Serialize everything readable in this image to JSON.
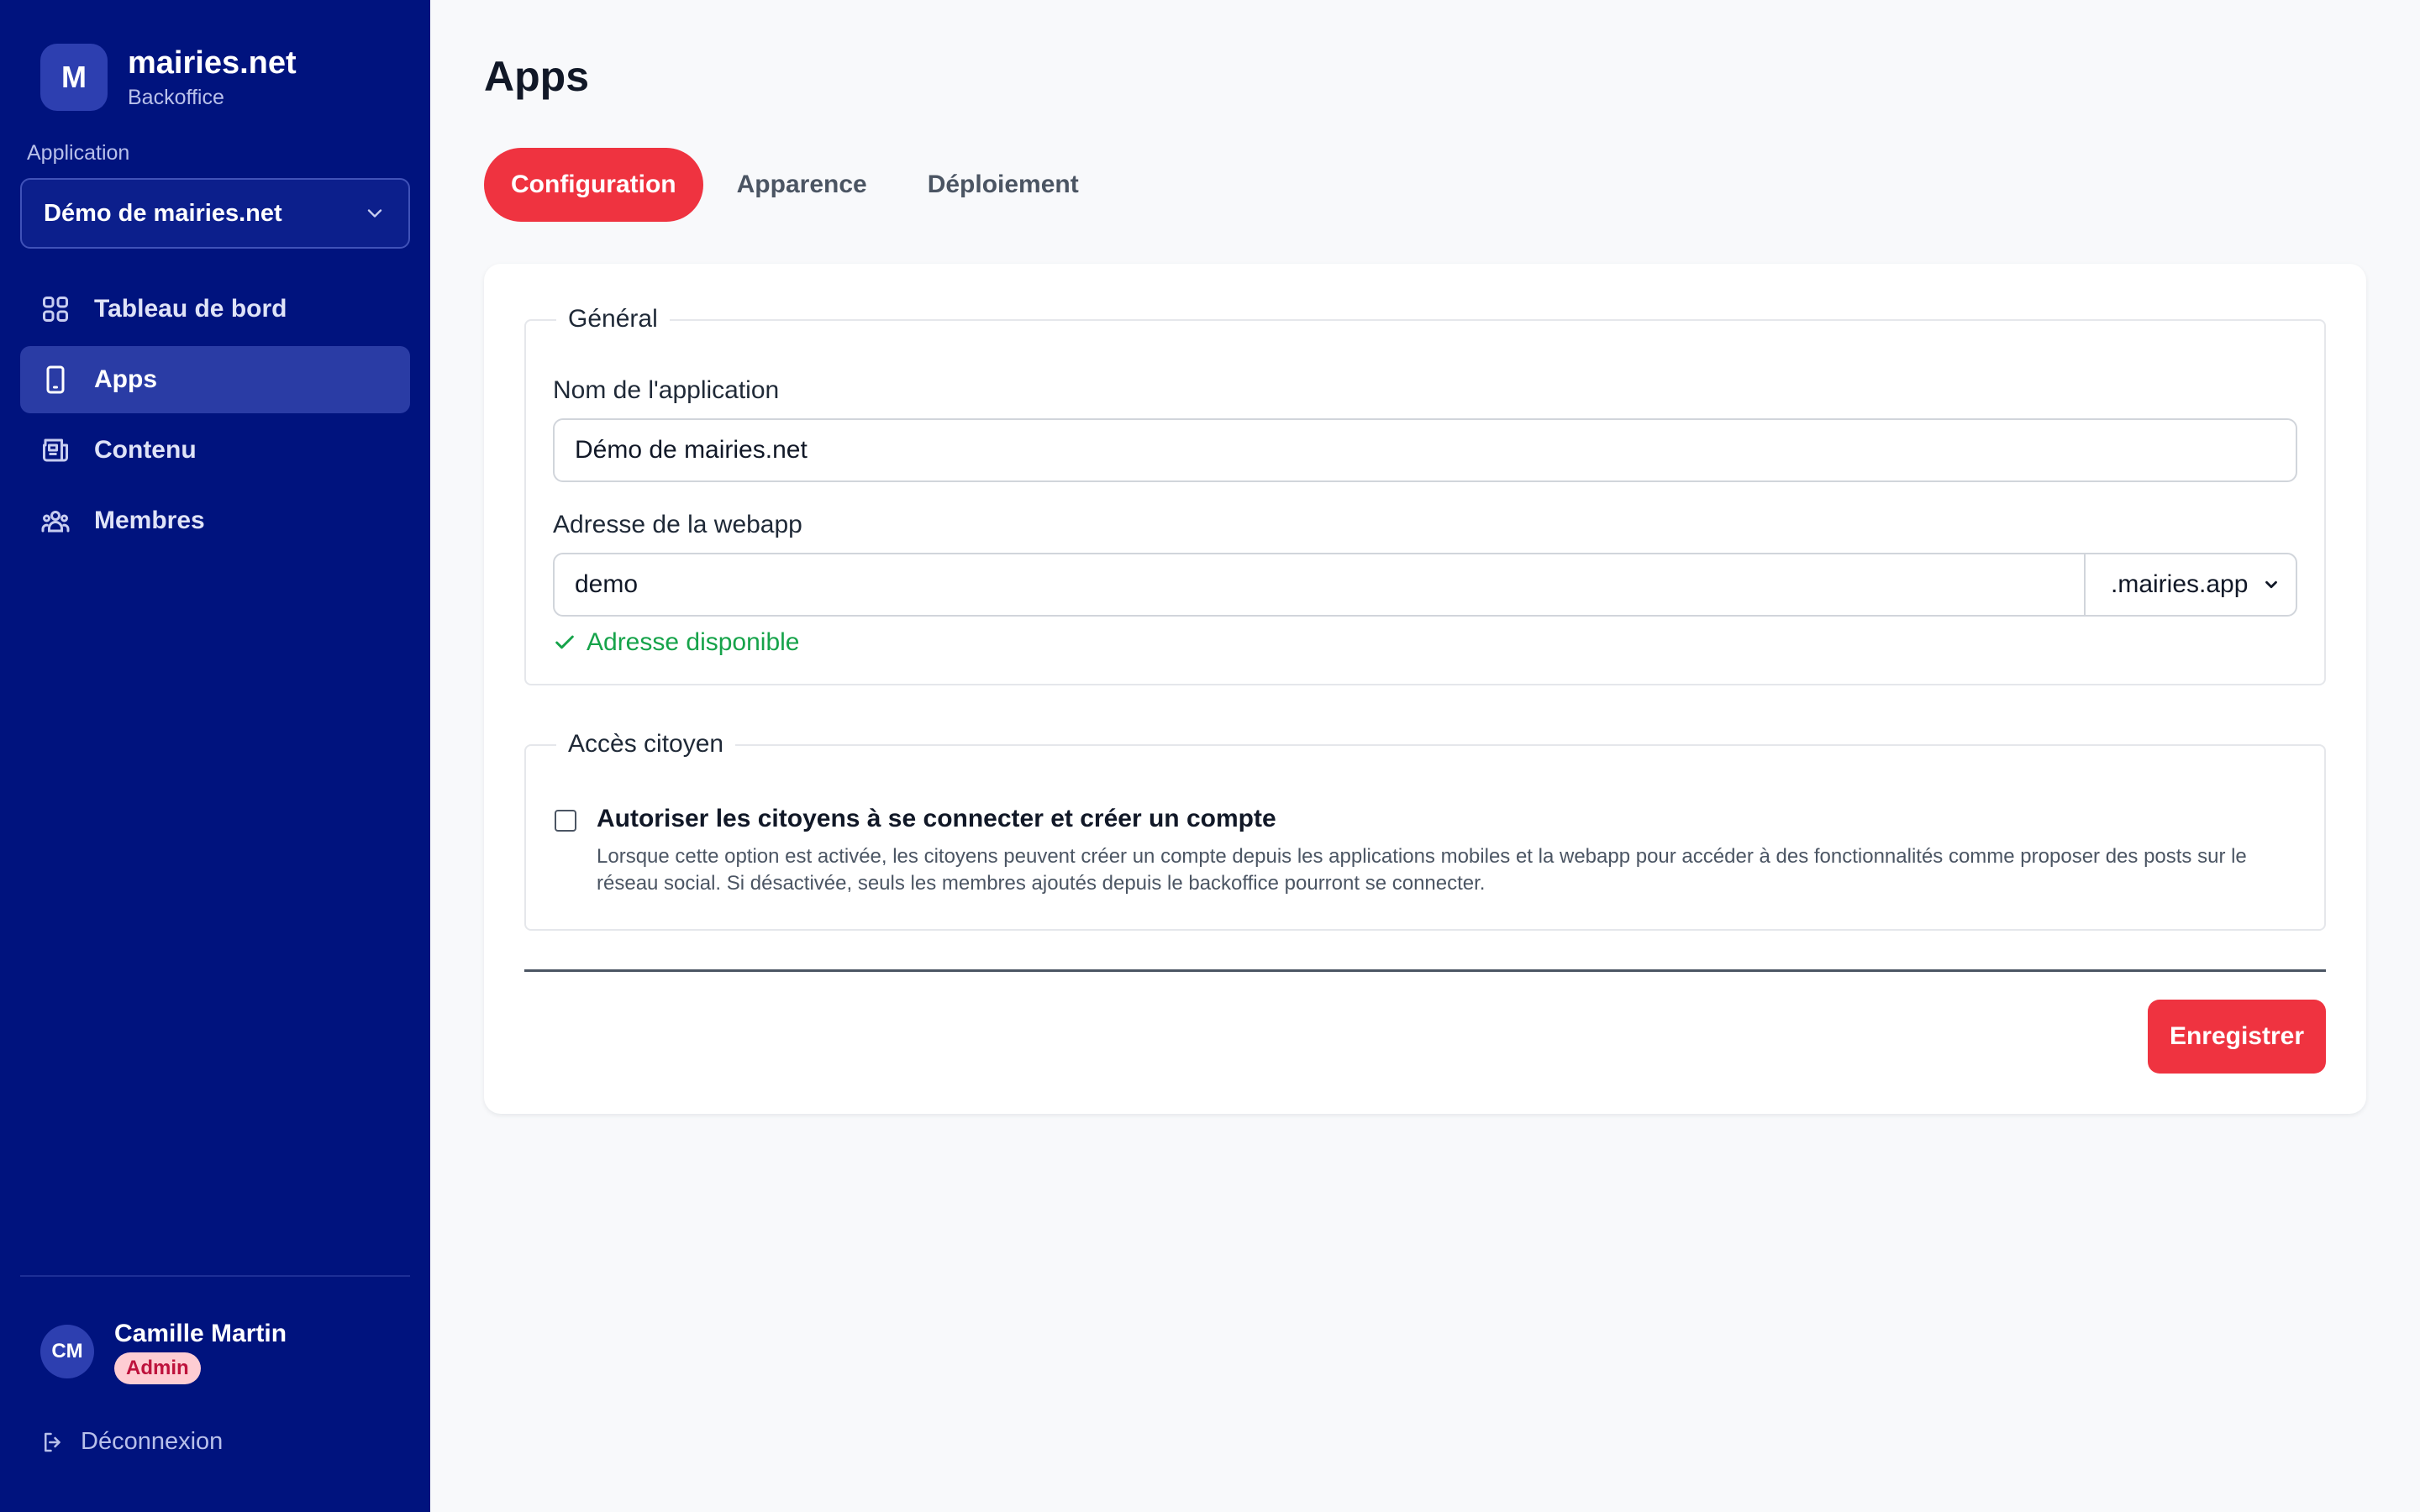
{
  "brand": {
    "initial": "M",
    "name": "mairies.net",
    "subtitle": "Backoffice"
  },
  "sidebar": {
    "application_label": "Application",
    "application_selected": "Démo de mairies.net",
    "nav": [
      {
        "label": "Tableau de bord",
        "icon": "grid-icon"
      },
      {
        "label": "Apps",
        "icon": "smartphone-icon",
        "active": true
      },
      {
        "label": "Contenu",
        "icon": "newspaper-icon"
      },
      {
        "label": "Membres",
        "icon": "users-icon"
      }
    ],
    "user": {
      "initials": "CM",
      "name": "Camille Martin",
      "role": "Admin"
    },
    "logout_label": "Déconnexion"
  },
  "page": {
    "title": "Apps",
    "tabs": [
      {
        "label": "Configuration",
        "active": true
      },
      {
        "label": "Apparence"
      },
      {
        "label": "Déploiement"
      }
    ]
  },
  "general": {
    "legend": "Général",
    "app_name_label": "Nom de l'application",
    "app_name_value": "Démo de mairies.net",
    "webapp_label": "Adresse de la webapp",
    "webapp_value": "demo",
    "webapp_suffix": ".mairies.app",
    "availability": "Adresse disponible"
  },
  "citizen": {
    "legend": "Accès citoyen",
    "allow_label": "Autoriser les citoyens à se connecter et créer un compte",
    "allow_checked": false,
    "description": "Lorsque cette option est activée, les citoyens peuvent créer un compte depuis les applications mobiles et la webapp pour accéder à des fonctionnalités comme proposer des posts sur le réseau social. Si désactivée, seuls les membres ajoutés depuis le backoffice pourront se connecter."
  },
  "actions": {
    "save_label": "Enregistrer"
  },
  "colors": {
    "sidebar": "#00137e",
    "accent": "#ef3340",
    "success": "#16a34a"
  }
}
